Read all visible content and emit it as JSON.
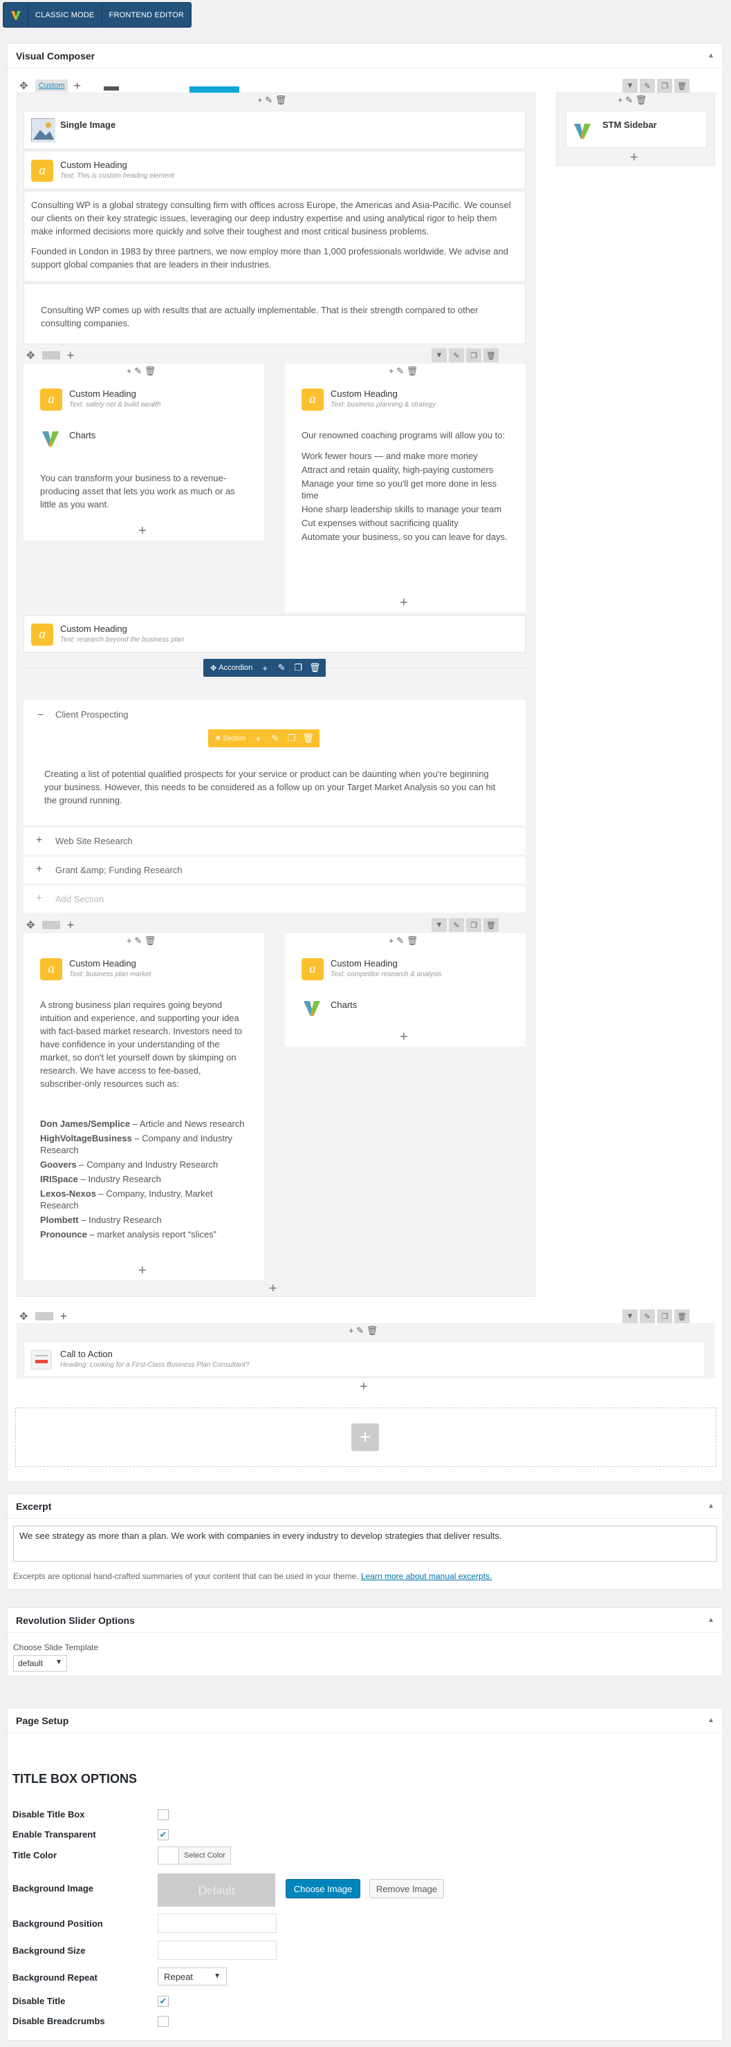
{
  "topbar": {
    "classic_label": "CLASSIC MODE",
    "frontend_label": "FRONTEND EDITOR"
  },
  "vc": {
    "title": "Visual Composer",
    "row1_layout": "Custom",
    "single_image": {
      "title": "Single Image"
    },
    "heading_intro": {
      "title": "Custom Heading",
      "sub": "Text: This is custom heading element"
    },
    "text1_p1": "Consulting WP is a global strategy consulting firm with offices across Europe, the Americas and Asia-Pacific. We counsel our clients on their key strategic issues, leveraging our deep industry expertise and using analytical rigor to help them make informed decisions more quickly and solve their toughest and most critical business problems.",
    "text1_p2": "Founded in London in 1983 by three partners, we now employ more than 1,000 professionals worldwide. We advise and support global companies that are leaders in their industries.",
    "text2": "Consulting WP comes up with results that are actually implementable. That is their strength compared to other consulting companies.",
    "sidebar": {
      "title": "STM Sidebar"
    },
    "inner1": {
      "left_heading": {
        "title": "Custom Heading",
        "sub": "Text: safety net & build wealth"
      },
      "left_charts": "Charts",
      "left_text": "You can transform your business to a revenue-producing asset that lets you work as much or as little as you want.",
      "right_heading": {
        "title": "Custom Heading",
        "sub": "Text: business planning & strategy"
      },
      "right_intro": "Our renowned coaching programs will allow you to:",
      "right_list": [
        "Work fewer hours — and make more money",
        "Attract and retain quality, high-paying customers",
        "Manage your time so you'll get more done in less time",
        "Hone sharp leadership skills to manage your team",
        "Cut expenses without sacrificing quality",
        "Automate your business, so you can leave for days."
      ]
    },
    "heading_research": {
      "title": "Custom Heading",
      "sub": "Text: research beyond the business plan"
    },
    "accordion": {
      "label": "Accordion",
      "section_label": "Section",
      "open_title": "Client Prospecting",
      "open_text": "Creating a list of potential qualified prospects for your service or product can be daunting when you're beginning your business. However, this needs to be considered as a follow up on your Target Market Analysis so you can hit the ground running.",
      "closed": [
        "Web Site Research",
        "Grant &amp; Funding Research"
      ],
      "add_section": "Add Section"
    },
    "inner2": {
      "left_heading": {
        "title": "Custom Heading",
        "sub": "Text: business plan market"
      },
      "left_text": "A strong business plan requires going beyond intuition and experience, and supporting your idea with fact-based market research. Investors need to have confidence in your understanding of the market, so don't let yourself down by skimping on research. We have access to fee-based, subscriber-only resources such as:",
      "resources": [
        {
          "name": "Don James/Semplice",
          "desc": " – Article and News research"
        },
        {
          "name": "HighVoltageBusiness",
          "desc": " – Company and Industry Research"
        },
        {
          "name": "Goovers",
          "desc": " – Company and Industry Research"
        },
        {
          "name": "IRISpace",
          "desc": " – Industry Research"
        },
        {
          "name": "Lexos-Nexos",
          "desc": " – Company, Industry, Market Research"
        },
        {
          "name": "Plombett",
          "desc": " – Industry Research"
        },
        {
          "name": "Pronounce",
          "desc": " – market analysis report “slices”"
        }
      ],
      "right_heading": {
        "title": "Custom Heading",
        "sub": "Text: competitor research & analysis"
      },
      "right_charts": "Charts"
    },
    "cta": {
      "title": "Call to Action",
      "sub": "Heading: Looking for a First-Class Business Plan Consultant?"
    }
  },
  "excerpt": {
    "title": "Excerpt",
    "value": "We see strategy as more than a plan. We work with companies in every industry to develop strategies that deliver results.",
    "help": "Excerpts are optional hand-crafted summaries of your content that can be used in your theme.",
    "help_link": "Learn more about manual excerpts."
  },
  "revslider": {
    "title": "Revolution Slider Options",
    "label": "Choose Slide Template",
    "value": "default"
  },
  "page_setup": {
    "title": "Page Setup",
    "section_title": "TITLE BOX OPTIONS",
    "disable_title_box": "Disable Title Box",
    "enable_transparent": "Enable Transparent",
    "title_color": "Title Color",
    "select_color": "Select Color",
    "background_image": "Background Image",
    "default_img": "Default",
    "choose_image": "Choose Image",
    "remove_image": "Remove Image",
    "background_position": "Background Position",
    "background_size": "Background Size",
    "background_repeat": "Background Repeat",
    "repeat_value": "Repeat",
    "disable_title": "Disable Title",
    "disable_breadcrumbs": "Disable Breadcrumbs"
  },
  "colors": {
    "accent": "#23527c",
    "heading_icon": "#fbc02d",
    "wp_blue": "#0085ba"
  }
}
